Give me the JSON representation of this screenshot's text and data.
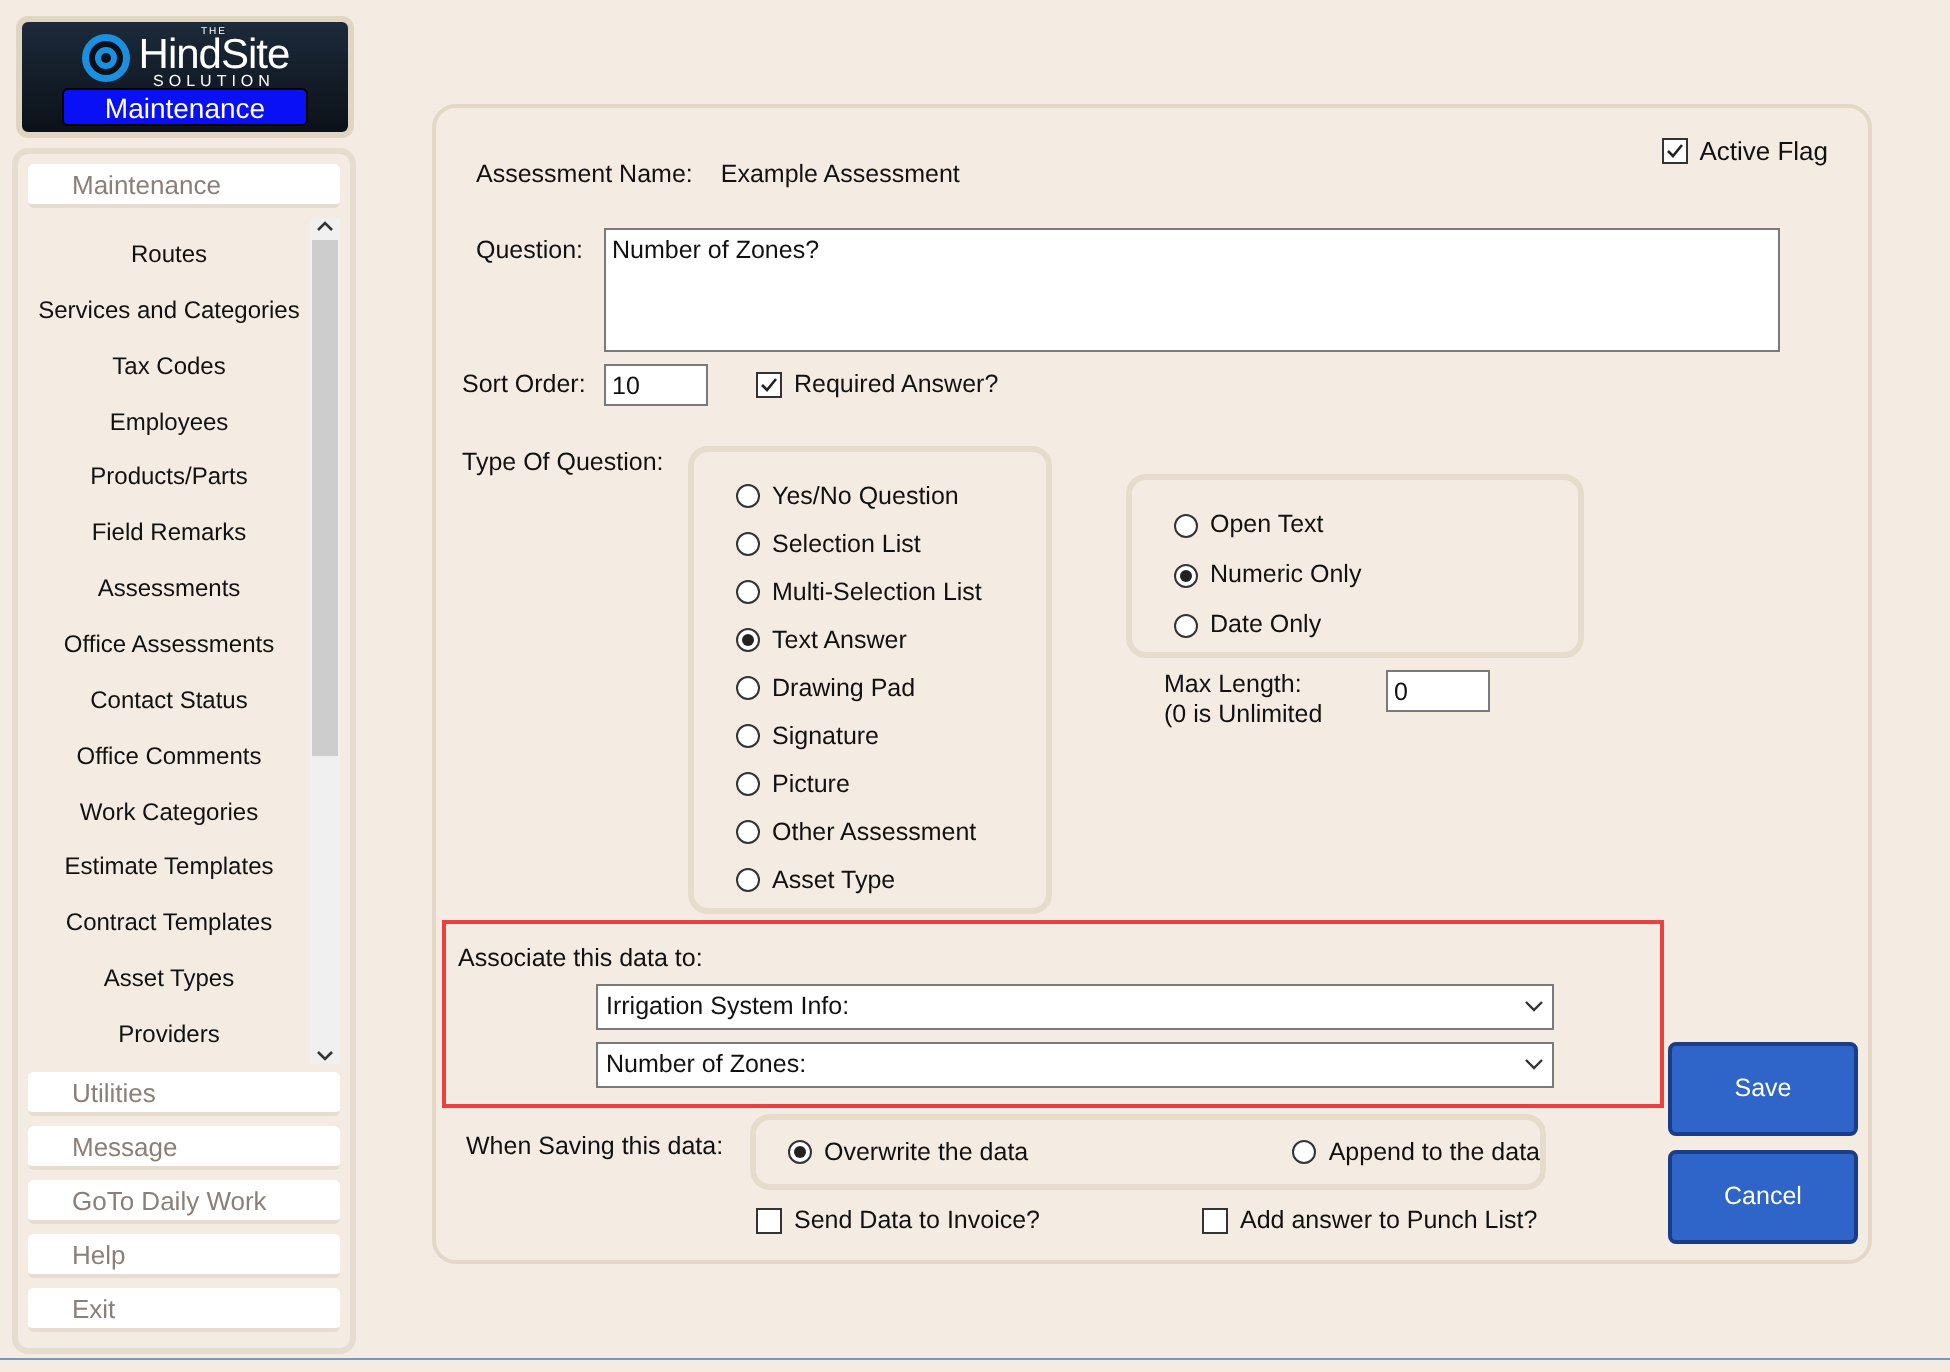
{
  "logo": {
    "prefix": "THE",
    "name": "HindSite",
    "tagline": "SOLUTION",
    "module": "Maintenance"
  },
  "sidebar": {
    "header": "Maintenance",
    "items": [
      "Routes",
      "Services and Categories",
      "Tax Codes",
      "Employees",
      "Products/Parts",
      "Field Remarks",
      "Assessments",
      "Office Assessments",
      "Contact Status",
      "Office Comments",
      "Work Categories",
      "Estimate Templates",
      "Contract Templates",
      "Asset Types",
      "Providers"
    ],
    "sections": [
      "Utilities",
      "Message",
      "GoTo Daily Work",
      "Help",
      "Exit"
    ]
  },
  "form": {
    "active_flag": {
      "label": "Active Flag",
      "checked": true
    },
    "assessment_name": {
      "label": "Assessment Name:",
      "value": "Example Assessment"
    },
    "question": {
      "label": "Question:",
      "value": "Number of Zones?"
    },
    "sort_order": {
      "label": "Sort Order:",
      "value": "10"
    },
    "required_answer": {
      "label": "Required Answer?",
      "checked": true
    },
    "type_of_question": {
      "label": "Type Of Question:",
      "options": [
        {
          "label": "Yes/No Question",
          "selected": false
        },
        {
          "label": "Selection List",
          "selected": false
        },
        {
          "label": "Multi-Selection List",
          "selected": false
        },
        {
          "label": "Text Answer",
          "selected": true
        },
        {
          "label": "Drawing Pad",
          "selected": false
        },
        {
          "label": "Signature",
          "selected": false
        },
        {
          "label": "Picture",
          "selected": false
        },
        {
          "label": "Other Assessment",
          "selected": false
        },
        {
          "label": "Asset Type",
          "selected": false
        }
      ]
    },
    "answer_format": [
      {
        "label": "Open Text",
        "selected": false
      },
      {
        "label": "Numeric Only",
        "selected": true
      },
      {
        "label": "Date Only",
        "selected": false
      }
    ],
    "max_length": {
      "label": [
        "Max Length:",
        "(0 is Unlimited"
      ],
      "value": "0"
    },
    "associate": {
      "label": "Associate this data to:",
      "dropdowns": [
        "Irrigation System Info:",
        "Number of Zones:"
      ]
    },
    "when_saving": {
      "label": "When Saving this data:",
      "options": [
        {
          "label": "Overwrite the data",
          "selected": true
        },
        {
          "label": "Append to the data",
          "selected": false
        }
      ]
    },
    "options": [
      {
        "label": "Send Data to Invoice?",
        "checked": false
      },
      {
        "label": "Add answer to Punch List?",
        "checked": false
      }
    ],
    "buttons": [
      "Save",
      "Cancel"
    ]
  }
}
